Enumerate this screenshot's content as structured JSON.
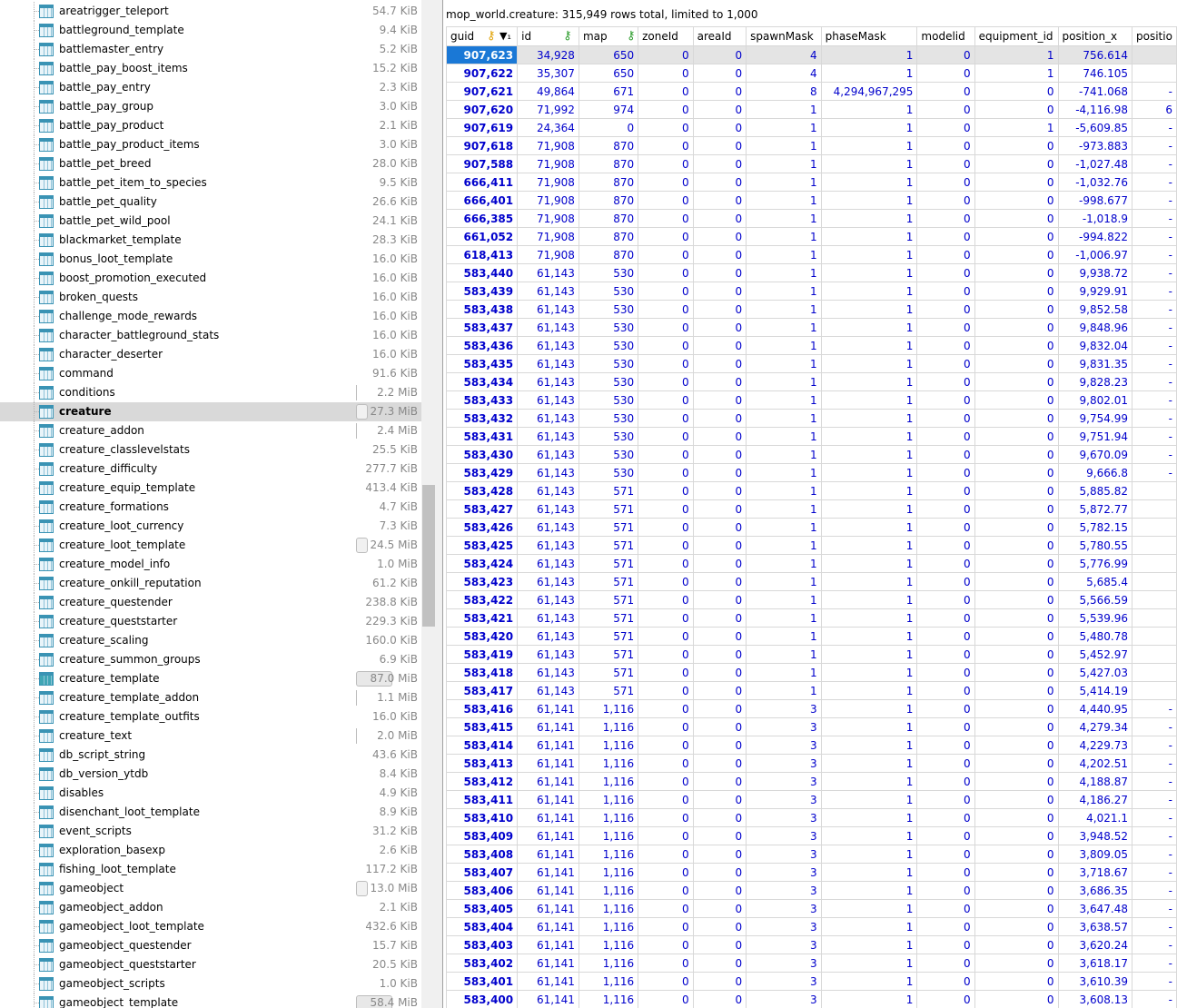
{
  "tree": {
    "items": [
      {
        "name": "areatrigger_teleport",
        "size": "54.7 KiB",
        "bar": "",
        "alt": false
      },
      {
        "name": "battleground_template",
        "size": "9.4 KiB",
        "bar": "",
        "alt": false
      },
      {
        "name": "battlemaster_entry",
        "size": "5.2 KiB",
        "bar": "",
        "alt": false
      },
      {
        "name": "battle_pay_boost_items",
        "size": "15.2 KiB",
        "bar": "",
        "alt": false
      },
      {
        "name": "battle_pay_entry",
        "size": "2.3 KiB",
        "bar": "",
        "alt": false
      },
      {
        "name": "battle_pay_group",
        "size": "3.0 KiB",
        "bar": "",
        "alt": false
      },
      {
        "name": "battle_pay_product",
        "size": "2.1 KiB",
        "bar": "",
        "alt": false
      },
      {
        "name": "battle_pay_product_items",
        "size": "3.0 KiB",
        "bar": "",
        "alt": false
      },
      {
        "name": "battle_pet_breed",
        "size": "28.0 KiB",
        "bar": "",
        "alt": false
      },
      {
        "name": "battle_pet_item_to_species",
        "size": "9.5 KiB",
        "bar": "",
        "alt": false
      },
      {
        "name": "battle_pet_quality",
        "size": "26.6 KiB",
        "bar": "",
        "alt": false
      },
      {
        "name": "battle_pet_wild_pool",
        "size": "24.1 KiB",
        "bar": "",
        "alt": false
      },
      {
        "name": "blackmarket_template",
        "size": "28.3 KiB",
        "bar": "",
        "alt": false
      },
      {
        "name": "bonus_loot_template",
        "size": "16.0 KiB",
        "bar": "",
        "alt": false
      },
      {
        "name": "boost_promotion_executed",
        "size": "16.0 KiB",
        "bar": "",
        "alt": false
      },
      {
        "name": "broken_quests",
        "size": "16.0 KiB",
        "bar": "",
        "alt": false
      },
      {
        "name": "challenge_mode_rewards",
        "size": "16.0 KiB",
        "bar": "",
        "alt": false
      },
      {
        "name": "character_battleground_stats",
        "size": "16.0 KiB",
        "bar": "",
        "alt": false
      },
      {
        "name": "character_deserter",
        "size": "16.0 KiB",
        "bar": "",
        "alt": false
      },
      {
        "name": "command",
        "size": "91.6 KiB",
        "bar": "",
        "alt": false
      },
      {
        "name": "conditions",
        "size": "2.2 MiB",
        "bar": "thin",
        "alt": false
      },
      {
        "name": "creature",
        "size": "27.3 MiB",
        "bar": "box",
        "alt": false,
        "selected": true
      },
      {
        "name": "creature_addon",
        "size": "2.4 MiB",
        "bar": "thin",
        "alt": false
      },
      {
        "name": "creature_classlevelstats",
        "size": "25.5 KiB",
        "bar": "",
        "alt": false
      },
      {
        "name": "creature_difficulty",
        "size": "277.7 KiB",
        "bar": "",
        "alt": false
      },
      {
        "name": "creature_equip_template",
        "size": "413.4 KiB",
        "bar": "",
        "alt": false
      },
      {
        "name": "creature_formations",
        "size": "4.7 KiB",
        "bar": "",
        "alt": false
      },
      {
        "name": "creature_loot_currency",
        "size": "7.3 KiB",
        "bar": "",
        "alt": false
      },
      {
        "name": "creature_loot_template",
        "size": "24.5 MiB",
        "bar": "box",
        "alt": false
      },
      {
        "name": "creature_model_info",
        "size": "1.0 MiB",
        "bar": "",
        "alt": false
      },
      {
        "name": "creature_onkill_reputation",
        "size": "61.2 KiB",
        "bar": "",
        "alt": false
      },
      {
        "name": "creature_questender",
        "size": "238.8 KiB",
        "bar": "",
        "alt": false
      },
      {
        "name": "creature_queststarter",
        "size": "229.3 KiB",
        "bar": "",
        "alt": false
      },
      {
        "name": "creature_scaling",
        "size": "160.0 KiB",
        "bar": "",
        "alt": false
      },
      {
        "name": "creature_summon_groups",
        "size": "6.9 KiB",
        "bar": "",
        "alt": false
      },
      {
        "name": "creature_template",
        "size": "87.0 MiB",
        "bar": "wide",
        "alt": true
      },
      {
        "name": "creature_template_addon",
        "size": "1.1 MiB",
        "bar": "thin",
        "alt": false
      },
      {
        "name": "creature_template_outfits",
        "size": "16.0 KiB",
        "bar": "",
        "alt": false
      },
      {
        "name": "creature_text",
        "size": "2.0 MiB",
        "bar": "thin",
        "alt": false
      },
      {
        "name": "db_script_string",
        "size": "43.6 KiB",
        "bar": "",
        "alt": false
      },
      {
        "name": "db_version_ytdb",
        "size": "8.4 KiB",
        "bar": "",
        "alt": false
      },
      {
        "name": "disables",
        "size": "4.9 KiB",
        "bar": "",
        "alt": false
      },
      {
        "name": "disenchant_loot_template",
        "size": "8.9 KiB",
        "bar": "",
        "alt": false
      },
      {
        "name": "event_scripts",
        "size": "31.2 KiB",
        "bar": "",
        "alt": false
      },
      {
        "name": "exploration_basexp",
        "size": "2.6 KiB",
        "bar": "",
        "alt": false
      },
      {
        "name": "fishing_loot_template",
        "size": "117.2 KiB",
        "bar": "",
        "alt": false
      },
      {
        "name": "gameobject",
        "size": "13.0 MiB",
        "bar": "box",
        "alt": false
      },
      {
        "name": "gameobject_addon",
        "size": "2.1 KiB",
        "bar": "",
        "alt": false
      },
      {
        "name": "gameobject_loot_template",
        "size": "432.6 KiB",
        "bar": "",
        "alt": false
      },
      {
        "name": "gameobject_questender",
        "size": "15.7 KiB",
        "bar": "",
        "alt": false
      },
      {
        "name": "gameobject_queststarter",
        "size": "20.5 KiB",
        "bar": "",
        "alt": false
      },
      {
        "name": "gameobject_scripts",
        "size": "1.0 KiB",
        "bar": "",
        "alt": false
      },
      {
        "name": "gameobject_template",
        "size": "58.4 MiB",
        "bar": "wide",
        "alt": false
      }
    ]
  },
  "result": {
    "title": "mop_world.creature: 315,949 rows total, limited to 1,000",
    "columns": [
      {
        "label": "guid",
        "w": 80,
        "marks": "guid"
      },
      {
        "label": "id",
        "w": 70,
        "marks": "id"
      },
      {
        "label": "map",
        "w": 68,
        "marks": "map"
      },
      {
        "label": "zoneId",
        "w": 62,
        "marks": ""
      },
      {
        "label": "areaId",
        "w": 60,
        "marks": ""
      },
      {
        "label": "spawnMask",
        "w": 83,
        "marks": ""
      },
      {
        "label": "phaseMask",
        "w": 107,
        "marks": ""
      },
      {
        "label": "modelid",
        "w": 64,
        "marks": ""
      },
      {
        "label": "equipment_id",
        "w": 92,
        "marks": ""
      },
      {
        "label": "position_x",
        "w": 83,
        "marks": ""
      },
      {
        "label": "positio",
        "w": 40,
        "marks": ""
      }
    ],
    "rows": [
      [
        "907,623",
        "34,928",
        "650",
        "0",
        "0",
        "4",
        "1",
        "0",
        "1",
        "756.614",
        ""
      ],
      [
        "907,622",
        "35,307",
        "650",
        "0",
        "0",
        "4",
        "1",
        "0",
        "1",
        "746.105",
        ""
      ],
      [
        "907,621",
        "49,864",
        "671",
        "0",
        "0",
        "8",
        "4,294,967,295",
        "0",
        "0",
        "-741.068",
        "-"
      ],
      [
        "907,620",
        "71,992",
        "974",
        "0",
        "0",
        "1",
        "1",
        "0",
        "0",
        "-4,116.98",
        "6"
      ],
      [
        "907,619",
        "24,364",
        "0",
        "0",
        "0",
        "1",
        "1",
        "0",
        "1",
        "-5,609.85",
        "-"
      ],
      [
        "907,618",
        "71,908",
        "870",
        "0",
        "0",
        "1",
        "1",
        "0",
        "0",
        "-973.883",
        "-"
      ],
      [
        "907,588",
        "71,908",
        "870",
        "0",
        "0",
        "1",
        "1",
        "0",
        "0",
        "-1,027.48",
        "-"
      ],
      [
        "666,411",
        "71,908",
        "870",
        "0",
        "0",
        "1",
        "1",
        "0",
        "0",
        "-1,032.76",
        "-"
      ],
      [
        "666,401",
        "71,908",
        "870",
        "0",
        "0",
        "1",
        "1",
        "0",
        "0",
        "-998.677",
        "-"
      ],
      [
        "666,385",
        "71,908",
        "870",
        "0",
        "0",
        "1",
        "1",
        "0",
        "0",
        "-1,018.9",
        "-"
      ],
      [
        "661,052",
        "71,908",
        "870",
        "0",
        "0",
        "1",
        "1",
        "0",
        "0",
        "-994.822",
        "-"
      ],
      [
        "618,413",
        "71,908",
        "870",
        "0",
        "0",
        "1",
        "1",
        "0",
        "0",
        "-1,006.97",
        "-"
      ],
      [
        "583,440",
        "61,143",
        "530",
        "0",
        "0",
        "1",
        "1",
        "0",
        "0",
        "9,938.72",
        "-"
      ],
      [
        "583,439",
        "61,143",
        "530",
        "0",
        "0",
        "1",
        "1",
        "0",
        "0",
        "9,929.91",
        "-"
      ],
      [
        "583,438",
        "61,143",
        "530",
        "0",
        "0",
        "1",
        "1",
        "0",
        "0",
        "9,852.58",
        "-"
      ],
      [
        "583,437",
        "61,143",
        "530",
        "0",
        "0",
        "1",
        "1",
        "0",
        "0",
        "9,848.96",
        "-"
      ],
      [
        "583,436",
        "61,143",
        "530",
        "0",
        "0",
        "1",
        "1",
        "0",
        "0",
        "9,832.04",
        "-"
      ],
      [
        "583,435",
        "61,143",
        "530",
        "0",
        "0",
        "1",
        "1",
        "0",
        "0",
        "9,831.35",
        "-"
      ],
      [
        "583,434",
        "61,143",
        "530",
        "0",
        "0",
        "1",
        "1",
        "0",
        "0",
        "9,828.23",
        "-"
      ],
      [
        "583,433",
        "61,143",
        "530",
        "0",
        "0",
        "1",
        "1",
        "0",
        "0",
        "9,802.01",
        "-"
      ],
      [
        "583,432",
        "61,143",
        "530",
        "0",
        "0",
        "1",
        "1",
        "0",
        "0",
        "9,754.99",
        "-"
      ],
      [
        "583,431",
        "61,143",
        "530",
        "0",
        "0",
        "1",
        "1",
        "0",
        "0",
        "9,751.94",
        "-"
      ],
      [
        "583,430",
        "61,143",
        "530",
        "0",
        "0",
        "1",
        "1",
        "0",
        "0",
        "9,670.09",
        "-"
      ],
      [
        "583,429",
        "61,143",
        "530",
        "0",
        "0",
        "1",
        "1",
        "0",
        "0",
        "9,666.8",
        "-"
      ],
      [
        "583,428",
        "61,143",
        "571",
        "0",
        "0",
        "1",
        "1",
        "0",
        "0",
        "5,885.82",
        ""
      ],
      [
        "583,427",
        "61,143",
        "571",
        "0",
        "0",
        "1",
        "1",
        "0",
        "0",
        "5,872.77",
        ""
      ],
      [
        "583,426",
        "61,143",
        "571",
        "0",
        "0",
        "1",
        "1",
        "0",
        "0",
        "5,782.15",
        ""
      ],
      [
        "583,425",
        "61,143",
        "571",
        "0",
        "0",
        "1",
        "1",
        "0",
        "0",
        "5,780.55",
        ""
      ],
      [
        "583,424",
        "61,143",
        "571",
        "0",
        "0",
        "1",
        "1",
        "0",
        "0",
        "5,776.99",
        ""
      ],
      [
        "583,423",
        "61,143",
        "571",
        "0",
        "0",
        "1",
        "1",
        "0",
        "0",
        "5,685.4",
        ""
      ],
      [
        "583,422",
        "61,143",
        "571",
        "0",
        "0",
        "1",
        "1",
        "0",
        "0",
        "5,566.59",
        ""
      ],
      [
        "583,421",
        "61,143",
        "571",
        "0",
        "0",
        "1",
        "1",
        "0",
        "0",
        "5,539.96",
        ""
      ],
      [
        "583,420",
        "61,143",
        "571",
        "0",
        "0",
        "1",
        "1",
        "0",
        "0",
        "5,480.78",
        ""
      ],
      [
        "583,419",
        "61,143",
        "571",
        "0",
        "0",
        "1",
        "1",
        "0",
        "0",
        "5,452.97",
        ""
      ],
      [
        "583,418",
        "61,143",
        "571",
        "0",
        "0",
        "1",
        "1",
        "0",
        "0",
        "5,427.03",
        ""
      ],
      [
        "583,417",
        "61,143",
        "571",
        "0",
        "0",
        "1",
        "1",
        "0",
        "0",
        "5,414.19",
        ""
      ],
      [
        "583,416",
        "61,141",
        "1,116",
        "0",
        "0",
        "3",
        "1",
        "0",
        "0",
        "4,440.95",
        "-"
      ],
      [
        "583,415",
        "61,141",
        "1,116",
        "0",
        "0",
        "3",
        "1",
        "0",
        "0",
        "4,279.34",
        "-"
      ],
      [
        "583,414",
        "61,141",
        "1,116",
        "0",
        "0",
        "3",
        "1",
        "0",
        "0",
        "4,229.73",
        "-"
      ],
      [
        "583,413",
        "61,141",
        "1,116",
        "0",
        "0",
        "3",
        "1",
        "0",
        "0",
        "4,202.51",
        "-"
      ],
      [
        "583,412",
        "61,141",
        "1,116",
        "0",
        "0",
        "3",
        "1",
        "0",
        "0",
        "4,188.87",
        "-"
      ],
      [
        "583,411",
        "61,141",
        "1,116",
        "0",
        "0",
        "3",
        "1",
        "0",
        "0",
        "4,186.27",
        "-"
      ],
      [
        "583,410",
        "61,141",
        "1,116",
        "0",
        "0",
        "3",
        "1",
        "0",
        "0",
        "4,021.1",
        "-"
      ],
      [
        "583,409",
        "61,141",
        "1,116",
        "0",
        "0",
        "3",
        "1",
        "0",
        "0",
        "3,948.52",
        "-"
      ],
      [
        "583,408",
        "61,141",
        "1,116",
        "0",
        "0",
        "3",
        "1",
        "0",
        "0",
        "3,809.05",
        "-"
      ],
      [
        "583,407",
        "61,141",
        "1,116",
        "0",
        "0",
        "3",
        "1",
        "0",
        "0",
        "3,718.67",
        "-"
      ],
      [
        "583,406",
        "61,141",
        "1,116",
        "0",
        "0",
        "3",
        "1",
        "0",
        "0",
        "3,686.35",
        "-"
      ],
      [
        "583,405",
        "61,141",
        "1,116",
        "0",
        "0",
        "3",
        "1",
        "0",
        "0",
        "3,647.48",
        "-"
      ],
      [
        "583,404",
        "61,141",
        "1,116",
        "0",
        "0",
        "3",
        "1",
        "0",
        "0",
        "3,638.57",
        "-"
      ],
      [
        "583,403",
        "61,141",
        "1,116",
        "0",
        "0",
        "3",
        "1",
        "0",
        "0",
        "3,620.24",
        "-"
      ],
      [
        "583,402",
        "61,141",
        "1,116",
        "0",
        "0",
        "3",
        "1",
        "0",
        "0",
        "3,618.17",
        "-"
      ],
      [
        "583,401",
        "61,141",
        "1,116",
        "0",
        "0",
        "3",
        "1",
        "0",
        "0",
        "3,610.39",
        "-"
      ],
      [
        "583,400",
        "61,141",
        "1,116",
        "0",
        "0",
        "3",
        "1",
        "0",
        "0",
        "3,608.13",
        "-"
      ]
    ]
  },
  "colors": {
    "value": "#0000cc",
    "selection": "#1a78d6",
    "key_primary": "#e0a000",
    "key_foreign": "#2c9c2c",
    "table_icon": "#3a93b4"
  },
  "icons": {
    "table": "table-icon",
    "primary_key": "primary-key-icon",
    "foreign_key": "foreign-key-icon",
    "sort": "sort-descending-icon"
  }
}
